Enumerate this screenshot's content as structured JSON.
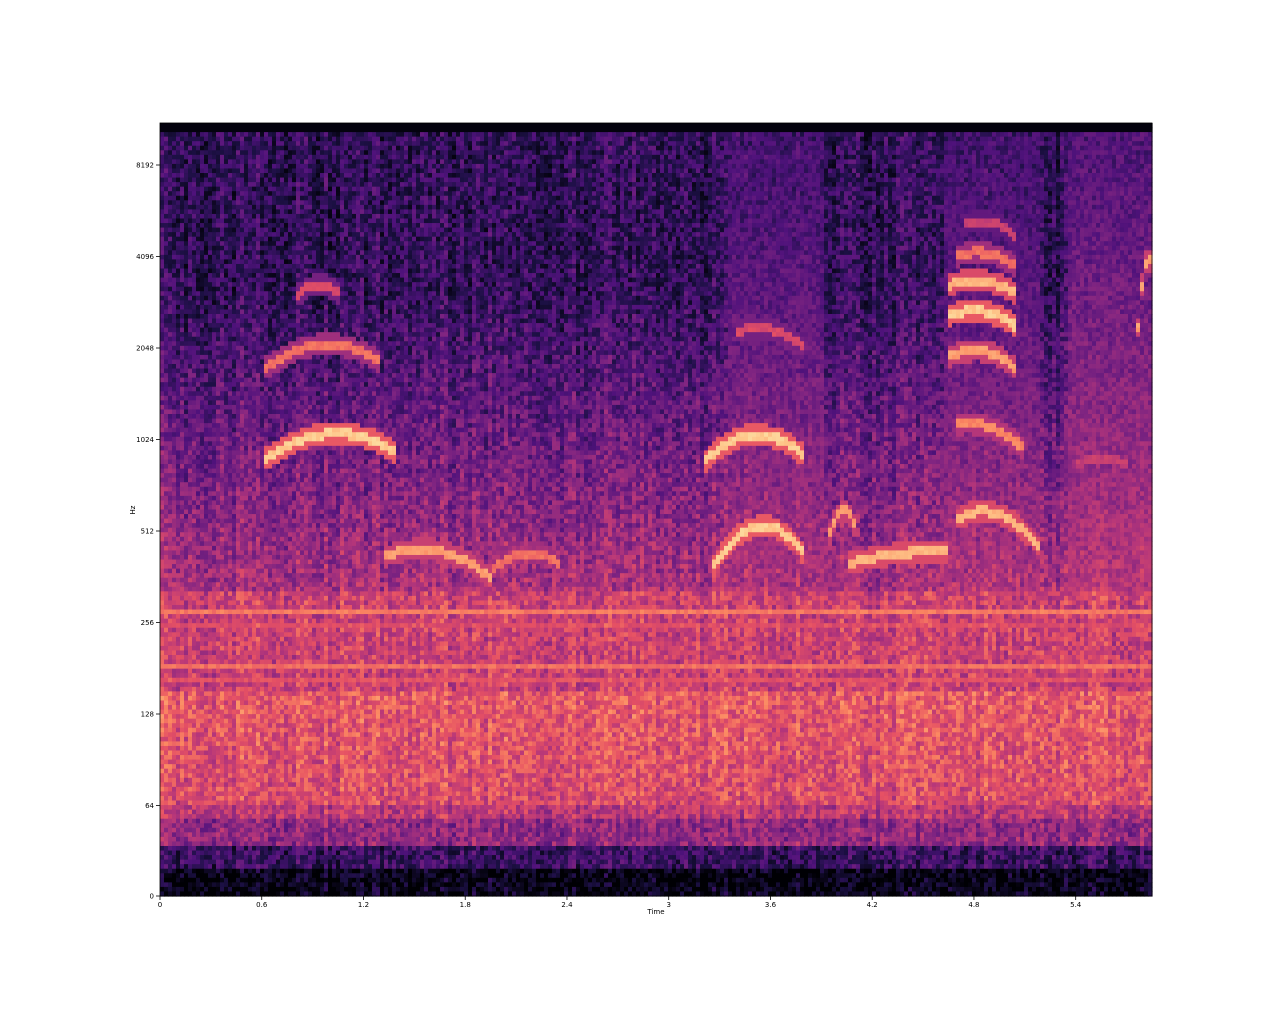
{
  "chart_data": {
    "type": "heatmap",
    "title": "",
    "xlabel": "Time",
    "ylabel": "Hz",
    "xlim": [
      0,
      5.85
    ],
    "x_ticks": [
      {
        "value": 0,
        "label": "0"
      },
      {
        "value": 0.6,
        "label": "0.6"
      },
      {
        "value": 1.2,
        "label": "1.2"
      },
      {
        "value": 1.8,
        "label": "1.8"
      },
      {
        "value": 2.4,
        "label": "2.4"
      },
      {
        "value": 3.0,
        "label": "3"
      },
      {
        "value": 3.6,
        "label": "3.6"
      },
      {
        "value": 4.2,
        "label": "4.2"
      },
      {
        "value": 4.8,
        "label": "4.8"
      },
      {
        "value": 5.4,
        "label": "5.4"
      }
    ],
    "y_scale": "log2",
    "ylim": [
      0,
      11025
    ],
    "y_ticks": [
      {
        "value": 0,
        "label": "0"
      },
      {
        "value": 64,
        "label": "64"
      },
      {
        "value": 128,
        "label": "128"
      },
      {
        "value": 256,
        "label": "256"
      },
      {
        "value": 512,
        "label": "512"
      },
      {
        "value": 1024,
        "label": "1024"
      },
      {
        "value": 2048,
        "label": "2048"
      },
      {
        "value": 4096,
        "label": "4096"
      },
      {
        "value": 8192,
        "label": "8192"
      }
    ],
    "colormap": "magma",
    "grid": false,
    "legend": "none",
    "bands": [
      {
        "freq_hz": 280,
        "intensity": 0.72
      },
      {
        "freq_hz": 250,
        "intensity": 0.6
      },
      {
        "freq_hz": 185,
        "intensity": 0.7
      },
      {
        "freq_hz": 165,
        "intensity": 0.62
      }
    ],
    "calls": [
      {
        "t_start": 0.62,
        "t_end": 1.38,
        "freq_start": 880,
        "freq_peak": 1070,
        "freq_end": 940,
        "intensity": 0.9
      },
      {
        "t_start": 0.62,
        "t_end": 1.3,
        "freq_start": 1750,
        "freq_peak": 2100,
        "freq_end": 1850,
        "intensity": 0.7
      },
      {
        "t_start": 0.8,
        "t_end": 1.05,
        "freq_start": 3000,
        "freq_peak": 3300,
        "freq_end": 3100,
        "intensity": 0.6
      },
      {
        "t_start": 1.32,
        "t_end": 1.95,
        "freq_start": 420,
        "freq_peak": 440,
        "freq_end": 360,
        "intensity": 0.8
      },
      {
        "t_start": 1.95,
        "t_end": 2.35,
        "freq_start": 380,
        "freq_peak": 430,
        "freq_end": 400,
        "intensity": 0.7
      },
      {
        "t_start": 3.2,
        "t_end": 3.8,
        "freq_start": 850,
        "freq_peak": 1060,
        "freq_end": 900,
        "intensity": 0.9
      },
      {
        "t_start": 3.25,
        "t_end": 3.8,
        "freq_start": 380,
        "freq_peak": 530,
        "freq_end": 430,
        "intensity": 0.9
      },
      {
        "t_start": 3.4,
        "t_end": 3.8,
        "freq_start": 2300,
        "freq_peak": 2350,
        "freq_end": 2050,
        "intensity": 0.6
      },
      {
        "t_start": 4.05,
        "t_end": 4.65,
        "freq_start": 400,
        "freq_peak": 430,
        "freq_end": 440,
        "intensity": 0.85
      },
      {
        "t_start": 3.95,
        "t_end": 4.1,
        "freq_start": 500,
        "freq_peak": 600,
        "freq_end": 520,
        "intensity": 0.8
      },
      {
        "t_start": 4.7,
        "t_end": 5.2,
        "freq_start": 560,
        "freq_peak": 580,
        "freq_end": 440,
        "intensity": 0.85
      },
      {
        "t_start": 4.7,
        "t_end": 5.1,
        "freq_start": 1150,
        "freq_peak": 1120,
        "freq_end": 950,
        "intensity": 0.75
      },
      {
        "t_start": 4.65,
        "t_end": 5.05,
        "freq_start": 1900,
        "freq_peak": 2000,
        "freq_end": 1750,
        "intensity": 0.8
      },
      {
        "t_start": 4.65,
        "t_end": 5.05,
        "freq_start": 2600,
        "freq_peak": 2700,
        "freq_end": 2400,
        "intensity": 0.9
      },
      {
        "t_start": 4.65,
        "t_end": 5.05,
        "freq_start": 3300,
        "freq_peak": 3400,
        "freq_end": 3100,
        "intensity": 0.85
      },
      {
        "t_start": 4.7,
        "t_end": 5.05,
        "freq_start": 4100,
        "freq_peak": 4200,
        "freq_end": 3800,
        "intensity": 0.7
      },
      {
        "t_start": 4.75,
        "t_end": 5.05,
        "freq_start": 5200,
        "freq_peak": 5300,
        "freq_end": 4700,
        "intensity": 0.55
      },
      {
        "t_start": 5.75,
        "t_end": 5.85,
        "freq_start": 1700,
        "freq_peak": 3600,
        "freq_end": 3800,
        "intensity": 0.8
      },
      {
        "t_start": 5.4,
        "t_end": 5.7,
        "freq_start": 860,
        "freq_peak": 870,
        "freq_end": 860,
        "intensity": 0.55
      }
    ],
    "broadband_segments": [
      {
        "t_start": 3.36,
        "t_end": 3.92,
        "intensity": 0.45
      },
      {
        "t_start": 4.62,
        "t_end": 5.2,
        "intensity": 0.45
      },
      {
        "t_start": 5.35,
        "t_end": 5.85,
        "intensity": 0.5
      }
    ]
  }
}
